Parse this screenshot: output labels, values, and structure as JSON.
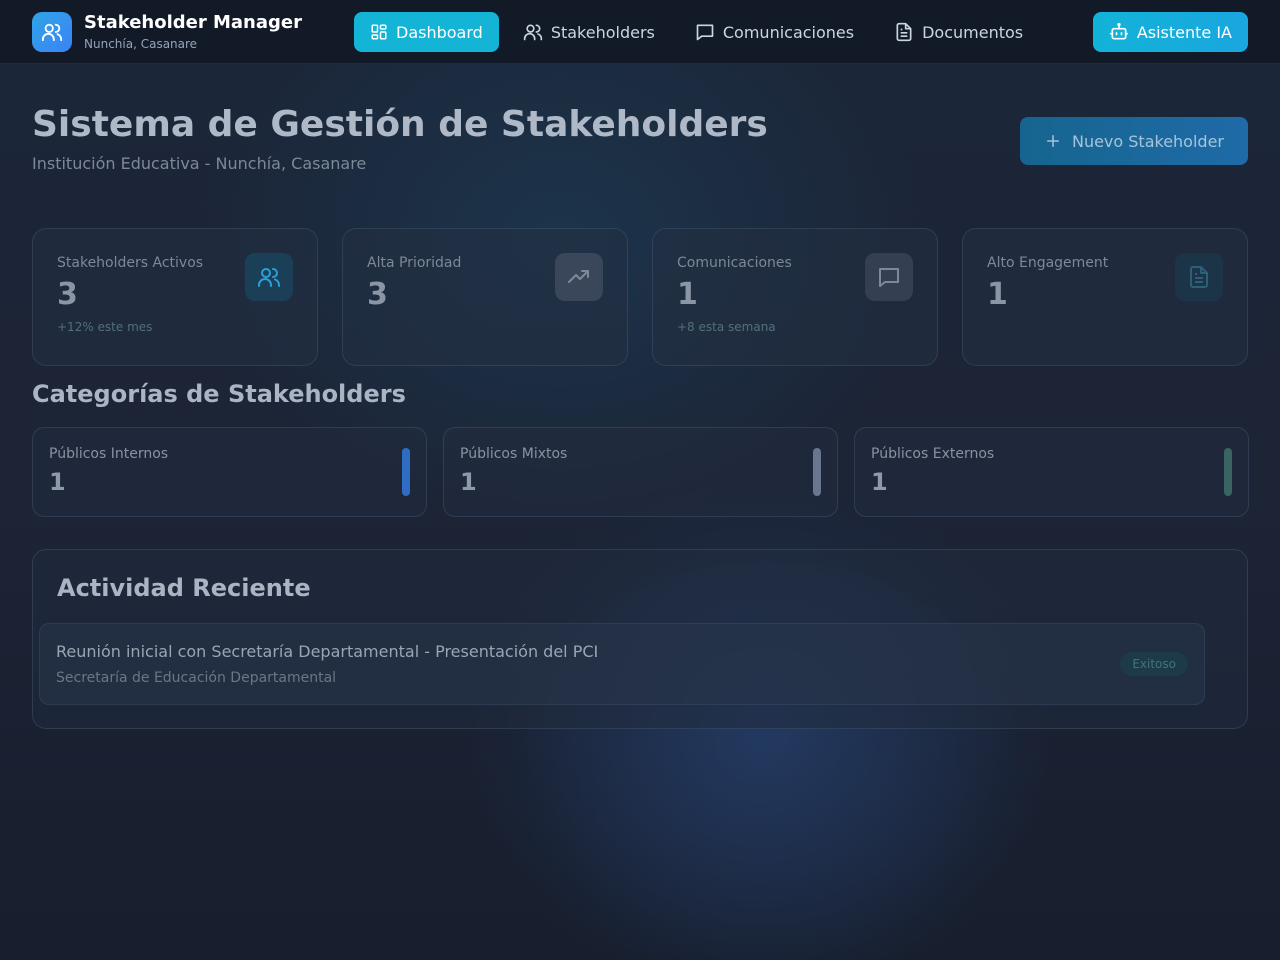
{
  "brand": {
    "title": "Stakeholder Manager",
    "subtitle": "Nunchía, Casanare",
    "logo_icon": "users-icon"
  },
  "nav": {
    "items": [
      {
        "label": "Dashboard",
        "icon": "dashboard-icon",
        "active": true
      },
      {
        "label": "Stakeholders",
        "icon": "users-icon",
        "active": false
      },
      {
        "label": "Comunicaciones",
        "icon": "message-icon",
        "active": false
      },
      {
        "label": "Documentos",
        "icon": "document-icon",
        "active": false
      }
    ],
    "ai_button": {
      "label": "Asistente IA",
      "icon": "bot-icon"
    }
  },
  "header": {
    "title": "Sistema de Gestión de Stakeholders",
    "subtitle": "Institución Educativa - Nunchía, Casanare",
    "new_button": "Nuevo Stakeholder"
  },
  "stats": [
    {
      "label": "Stakeholders Activos",
      "value": "3",
      "note": "+12% este mes",
      "icon": "users-icon",
      "accent": "#2a9fd6"
    },
    {
      "label": "Alta Prioridad",
      "value": "3",
      "note": "",
      "icon": "trending-up-icon",
      "accent": "#7d8898"
    },
    {
      "label": "Comunicaciones",
      "value": "1",
      "note": "+8 esta semana",
      "icon": "message-icon",
      "accent": "#7d8898"
    },
    {
      "label": "Alto Engagement",
      "value": "1",
      "note": "",
      "icon": "document-icon",
      "accent": "#2e5f78"
    }
  ],
  "categories": {
    "title": "Categorías de Stakeholders",
    "items": [
      {
        "label": "Públicos Internos",
        "value": "1",
        "color": "#2f6cc4"
      },
      {
        "label": "Públicos Mixtos",
        "value": "1",
        "color": "#6a7590"
      },
      {
        "label": "Públicos Externos",
        "value": "1",
        "color": "#3a6363"
      }
    ]
  },
  "activity": {
    "title": "Actividad Reciente",
    "items": [
      {
        "title": "Reunión inicial con Secretaría Departamental - Presentación del PCI",
        "subtitle": "Secretaría de Educación Departamental",
        "status": "Exitoso"
      }
    ]
  }
}
